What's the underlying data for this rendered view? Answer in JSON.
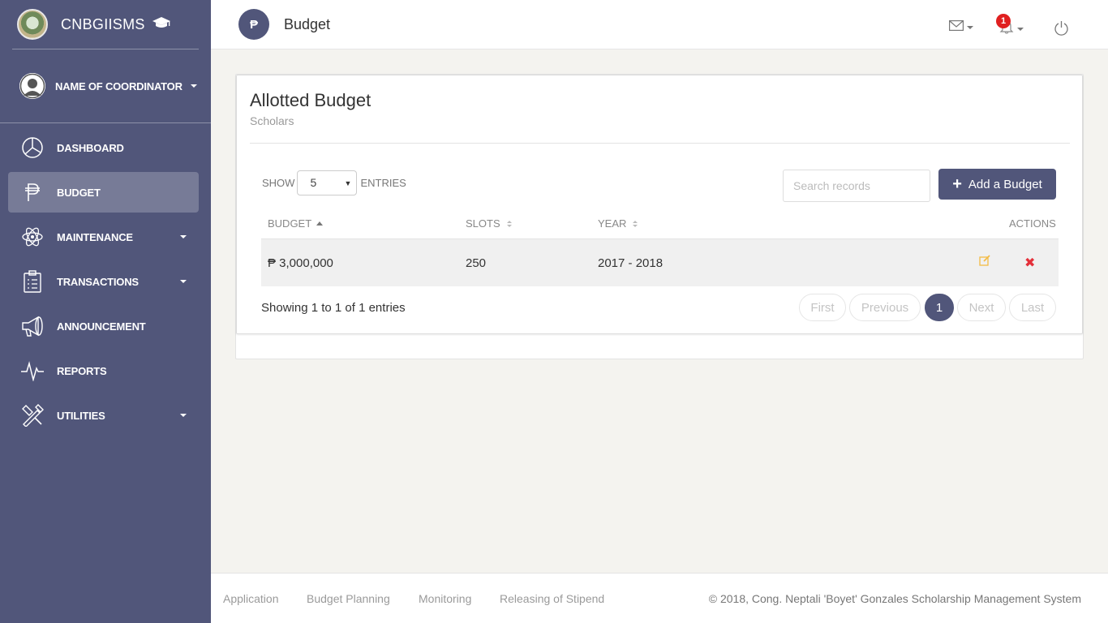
{
  "brand": {
    "name": "CNBGIISMS"
  },
  "user": {
    "name": "NAME OF COORDINATOR"
  },
  "nav": {
    "items": [
      {
        "label": "DASHBOARD"
      },
      {
        "label": "BUDGET"
      },
      {
        "label": "MAINTENANCE"
      },
      {
        "label": "TRANSACTIONS"
      },
      {
        "label": "ANNOUNCEMENT"
      },
      {
        "label": "REPORTS"
      },
      {
        "label": "UTILITIES"
      }
    ]
  },
  "topbar": {
    "page_icon": "₱",
    "title": "Budget",
    "notification_count": "1"
  },
  "card": {
    "title": "Allotted Budget",
    "subtitle": "Scholars",
    "show_label": "SHOW",
    "entries_value": "5",
    "entries_label": "ENTRIES",
    "search_placeholder": "Search records",
    "add_label": "Add a Budget",
    "columns": [
      "BUDGET",
      "SLOTS",
      "YEAR",
      "ACTIONS"
    ],
    "rows": [
      {
        "budget": "₱ 3,000,000",
        "slots": "250",
        "year": "2017 - 2018"
      }
    ],
    "info": "Showing 1 to 1 of 1 entries",
    "pagination": [
      "First",
      "Previous",
      "1",
      "Next",
      "Last"
    ]
  },
  "footer": {
    "links": [
      "Application",
      "Budget Planning",
      "Monitoring",
      "Releasing of Stipend"
    ],
    "copyright": "© 2018, Cong. Neptali 'Boyet' Gonzales Scholarship Management System"
  },
  "colors": {
    "sidebar": "#51567a",
    "accent": "#51567a",
    "edit": "#f3bb45",
    "delete": "#e4303a",
    "badge": "#e02020"
  }
}
